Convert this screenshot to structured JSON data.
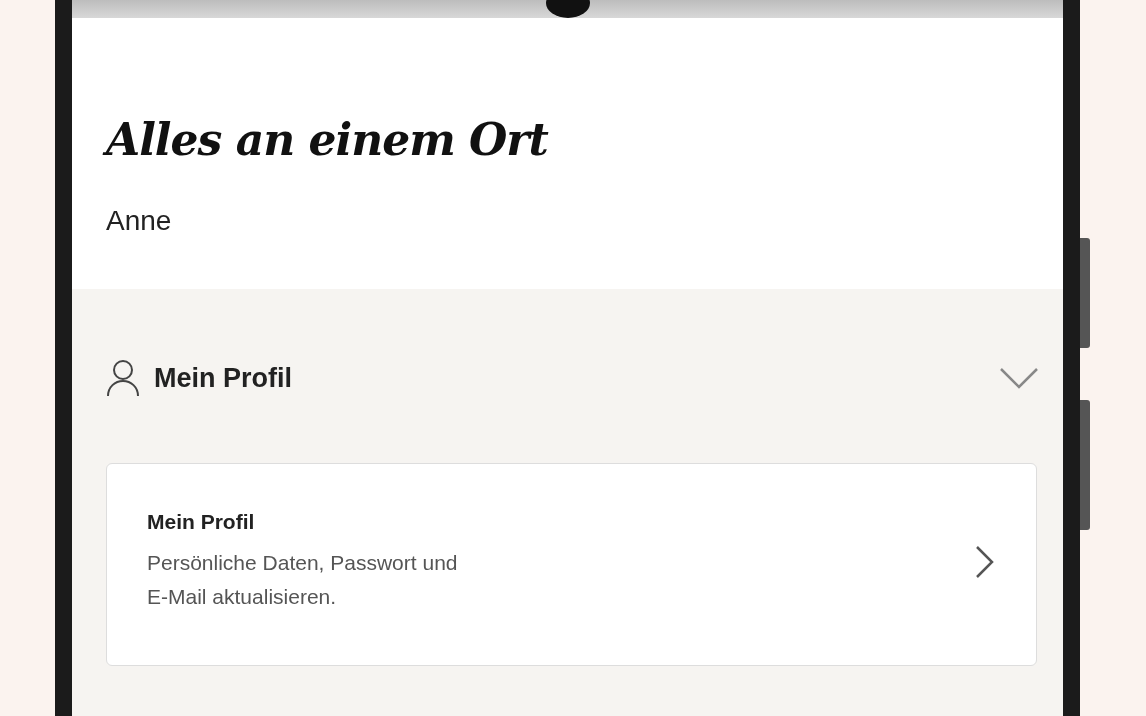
{
  "heading": "Alles an einem Ort",
  "user_name": "Anne",
  "section": {
    "title": "Mein Profil",
    "expanded": true,
    "cards": [
      {
        "title": "Mein Profil",
        "description": "Persönliche Daten, Passwort und\n E-Mail aktualisieren."
      }
    ]
  }
}
